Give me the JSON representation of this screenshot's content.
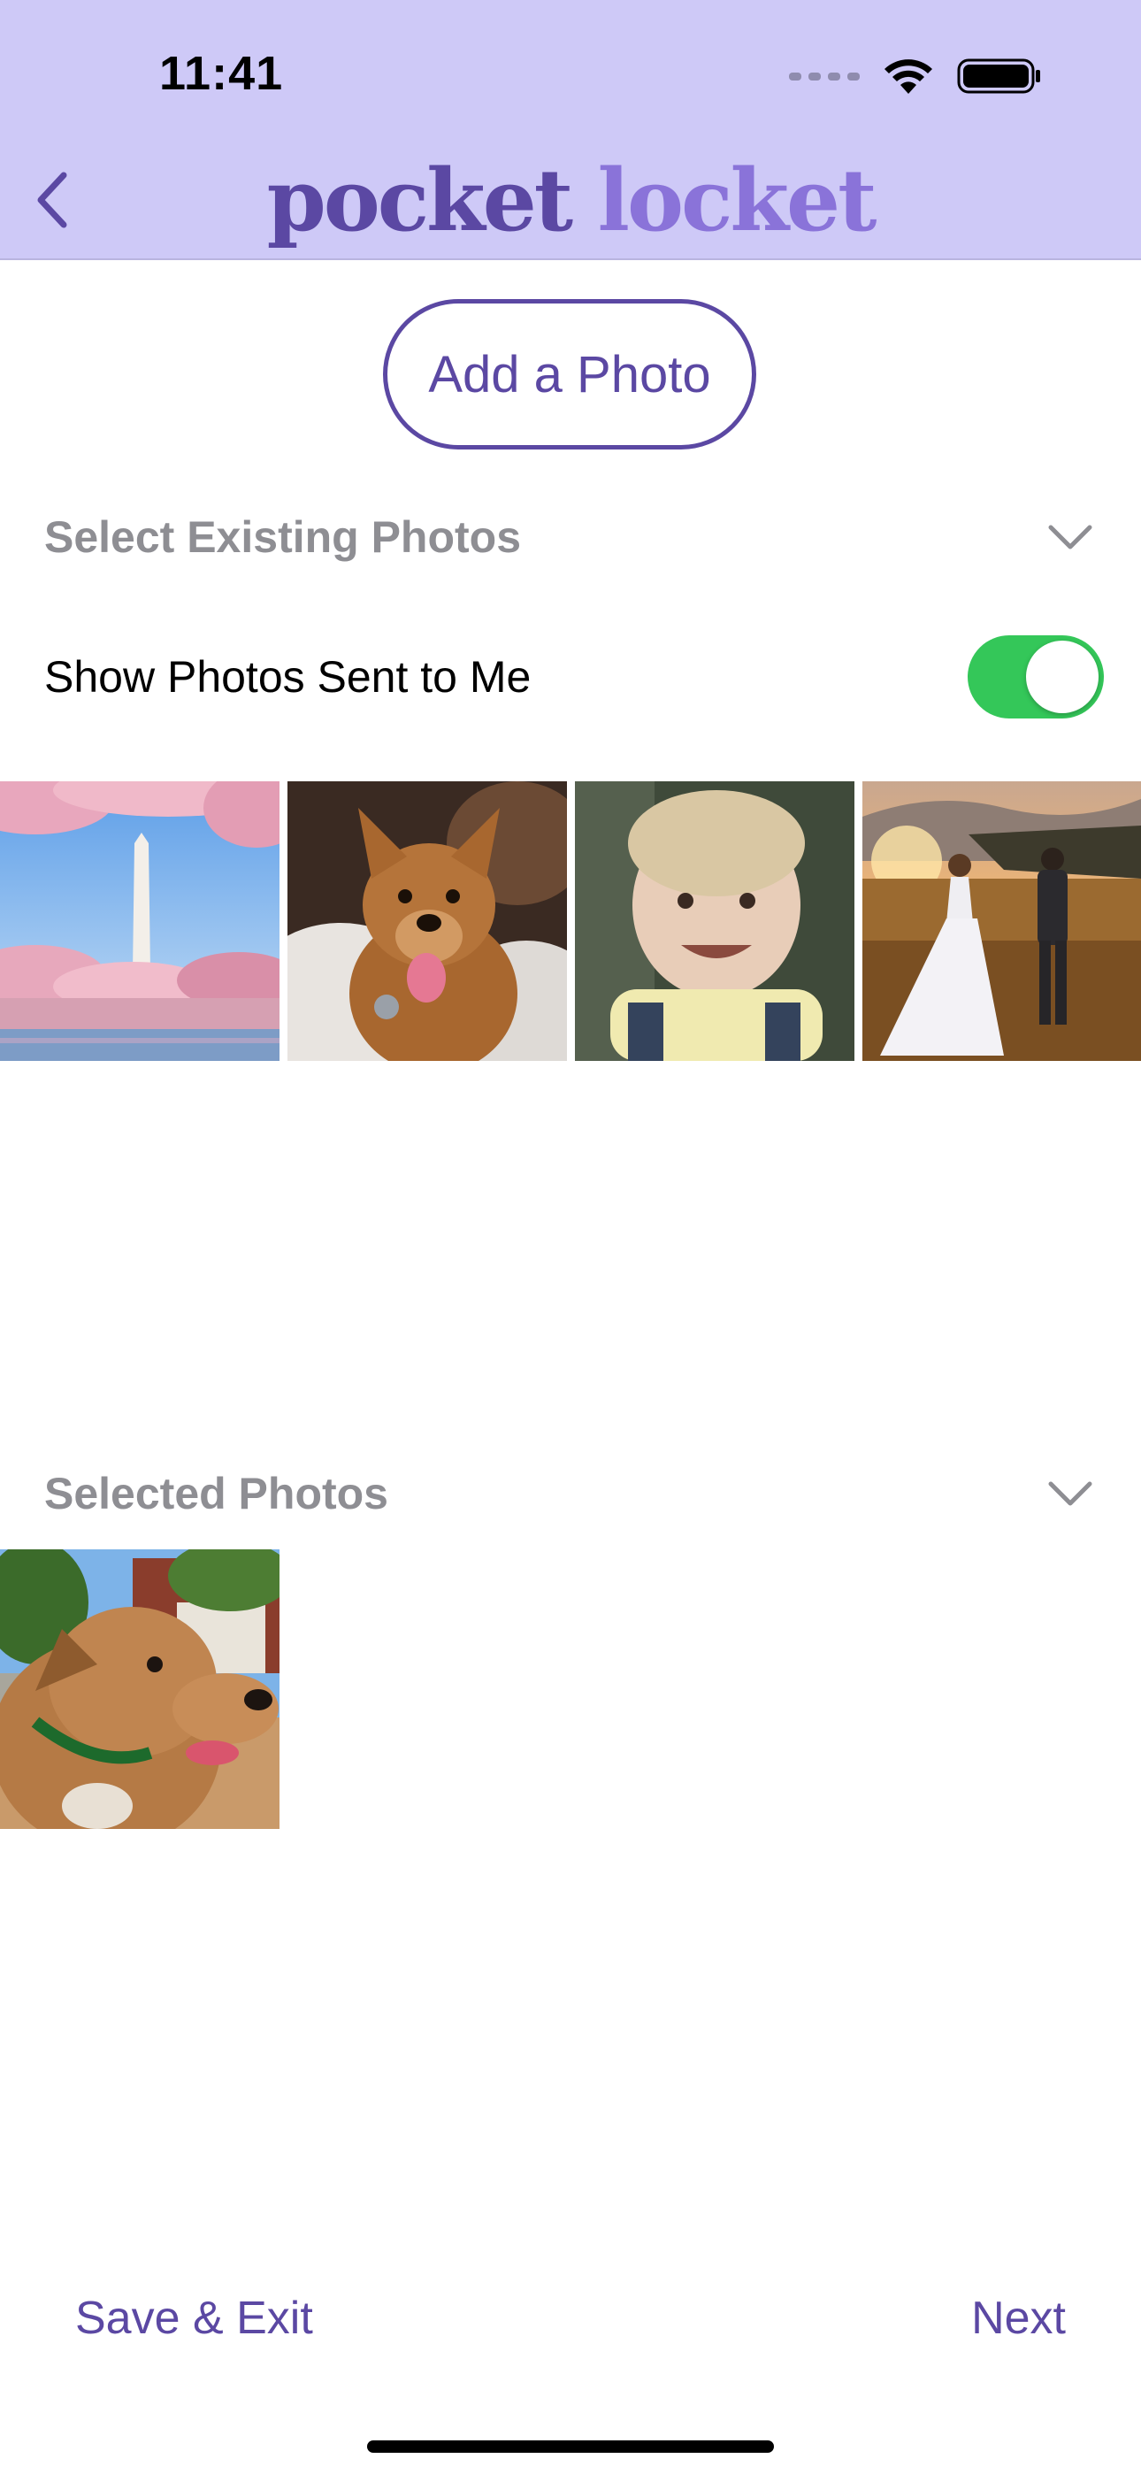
{
  "status_bar": {
    "time": "11:41"
  },
  "header": {
    "logo": {
      "word1": "pocket",
      "word2": "locket"
    },
    "icons": {
      "back": "chevron-left-icon"
    }
  },
  "actions": {
    "add_photo_label": "Add a Photo"
  },
  "existing_section": {
    "title": "Select Existing Photos",
    "toggle": {
      "label": "Show Photos Sent to Me",
      "on": true
    },
    "photos": [
      {
        "name": "monument-cherry-blossoms-photo"
      },
      {
        "name": "dog-on-blanket-photo"
      },
      {
        "name": "smiling-child-photo"
      },
      {
        "name": "wedding-couple-field-photo"
      }
    ]
  },
  "selected_section": {
    "title": "Selected Photos",
    "photos": [
      {
        "name": "dog-portrait-photo"
      }
    ]
  },
  "footer": {
    "save_exit_label": "Save & Exit",
    "next_label": "Next"
  },
  "colors": {
    "header_bg": "#cec9f7",
    "brand": "#5b48a3",
    "brand_light": "#8a73d9",
    "toggle_on": "#34c759",
    "section_gray": "#8e8e93"
  }
}
